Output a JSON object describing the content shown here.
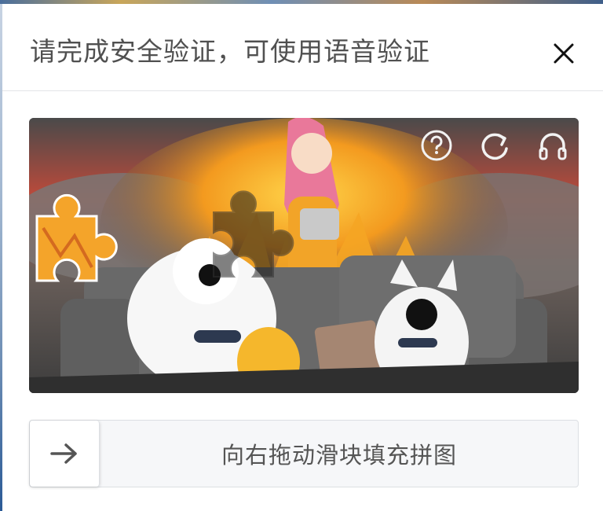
{
  "dialog": {
    "title": "请完成安全验证，可使用语音验证",
    "close_icon": "close-icon"
  },
  "captcha": {
    "image_description_icons": [
      "help-icon",
      "refresh-icon",
      "headphones-icon"
    ],
    "accent_colors": {
      "fire": "#f2a028",
      "smoke": "#5a5a5a",
      "sofa": "#6b6b6b"
    }
  },
  "slider": {
    "hint": "向右拖动滑块填充拼图",
    "handle_icon": "arrow-right-icon"
  }
}
